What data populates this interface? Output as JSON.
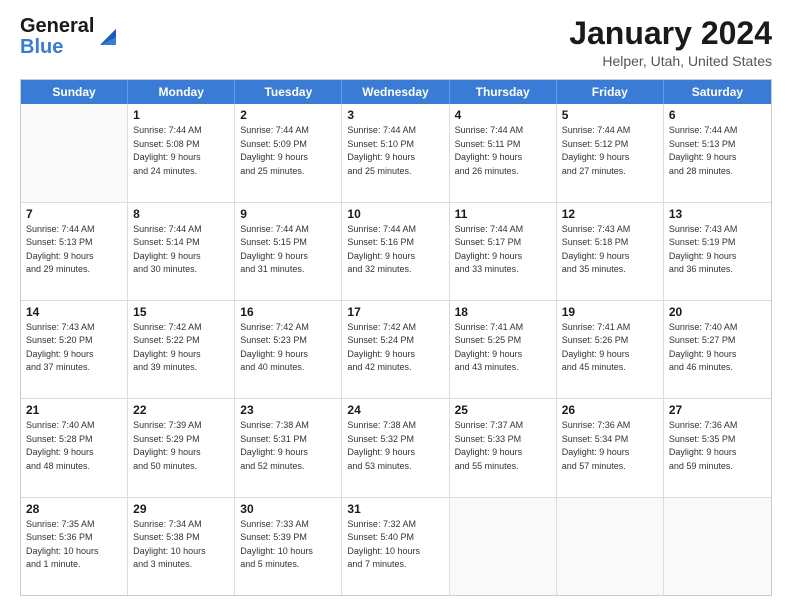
{
  "header": {
    "logo_line1": "General",
    "logo_line2": "Blue",
    "month_title": "January 2024",
    "location": "Helper, Utah, United States"
  },
  "calendar": {
    "days_of_week": [
      "Sunday",
      "Monday",
      "Tuesday",
      "Wednesday",
      "Thursday",
      "Friday",
      "Saturday"
    ],
    "weeks": [
      [
        {
          "day": "",
          "info": ""
        },
        {
          "day": "1",
          "info": "Sunrise: 7:44 AM\nSunset: 5:08 PM\nDaylight: 9 hours\nand 24 minutes."
        },
        {
          "day": "2",
          "info": "Sunrise: 7:44 AM\nSunset: 5:09 PM\nDaylight: 9 hours\nand 25 minutes."
        },
        {
          "day": "3",
          "info": "Sunrise: 7:44 AM\nSunset: 5:10 PM\nDaylight: 9 hours\nand 25 minutes."
        },
        {
          "day": "4",
          "info": "Sunrise: 7:44 AM\nSunset: 5:11 PM\nDaylight: 9 hours\nand 26 minutes."
        },
        {
          "day": "5",
          "info": "Sunrise: 7:44 AM\nSunset: 5:12 PM\nDaylight: 9 hours\nand 27 minutes."
        },
        {
          "day": "6",
          "info": "Sunrise: 7:44 AM\nSunset: 5:13 PM\nDaylight: 9 hours\nand 28 minutes."
        }
      ],
      [
        {
          "day": "7",
          "info": "Sunrise: 7:44 AM\nSunset: 5:13 PM\nDaylight: 9 hours\nand 29 minutes."
        },
        {
          "day": "8",
          "info": "Sunrise: 7:44 AM\nSunset: 5:14 PM\nDaylight: 9 hours\nand 30 minutes."
        },
        {
          "day": "9",
          "info": "Sunrise: 7:44 AM\nSunset: 5:15 PM\nDaylight: 9 hours\nand 31 minutes."
        },
        {
          "day": "10",
          "info": "Sunrise: 7:44 AM\nSunset: 5:16 PM\nDaylight: 9 hours\nand 32 minutes."
        },
        {
          "day": "11",
          "info": "Sunrise: 7:44 AM\nSunset: 5:17 PM\nDaylight: 9 hours\nand 33 minutes."
        },
        {
          "day": "12",
          "info": "Sunrise: 7:43 AM\nSunset: 5:18 PM\nDaylight: 9 hours\nand 35 minutes."
        },
        {
          "day": "13",
          "info": "Sunrise: 7:43 AM\nSunset: 5:19 PM\nDaylight: 9 hours\nand 36 minutes."
        }
      ],
      [
        {
          "day": "14",
          "info": "Sunrise: 7:43 AM\nSunset: 5:20 PM\nDaylight: 9 hours\nand 37 minutes."
        },
        {
          "day": "15",
          "info": "Sunrise: 7:42 AM\nSunset: 5:22 PM\nDaylight: 9 hours\nand 39 minutes."
        },
        {
          "day": "16",
          "info": "Sunrise: 7:42 AM\nSunset: 5:23 PM\nDaylight: 9 hours\nand 40 minutes."
        },
        {
          "day": "17",
          "info": "Sunrise: 7:42 AM\nSunset: 5:24 PM\nDaylight: 9 hours\nand 42 minutes."
        },
        {
          "day": "18",
          "info": "Sunrise: 7:41 AM\nSunset: 5:25 PM\nDaylight: 9 hours\nand 43 minutes."
        },
        {
          "day": "19",
          "info": "Sunrise: 7:41 AM\nSunset: 5:26 PM\nDaylight: 9 hours\nand 45 minutes."
        },
        {
          "day": "20",
          "info": "Sunrise: 7:40 AM\nSunset: 5:27 PM\nDaylight: 9 hours\nand 46 minutes."
        }
      ],
      [
        {
          "day": "21",
          "info": "Sunrise: 7:40 AM\nSunset: 5:28 PM\nDaylight: 9 hours\nand 48 minutes."
        },
        {
          "day": "22",
          "info": "Sunrise: 7:39 AM\nSunset: 5:29 PM\nDaylight: 9 hours\nand 50 minutes."
        },
        {
          "day": "23",
          "info": "Sunrise: 7:38 AM\nSunset: 5:31 PM\nDaylight: 9 hours\nand 52 minutes."
        },
        {
          "day": "24",
          "info": "Sunrise: 7:38 AM\nSunset: 5:32 PM\nDaylight: 9 hours\nand 53 minutes."
        },
        {
          "day": "25",
          "info": "Sunrise: 7:37 AM\nSunset: 5:33 PM\nDaylight: 9 hours\nand 55 minutes."
        },
        {
          "day": "26",
          "info": "Sunrise: 7:36 AM\nSunset: 5:34 PM\nDaylight: 9 hours\nand 57 minutes."
        },
        {
          "day": "27",
          "info": "Sunrise: 7:36 AM\nSunset: 5:35 PM\nDaylight: 9 hours\nand 59 minutes."
        }
      ],
      [
        {
          "day": "28",
          "info": "Sunrise: 7:35 AM\nSunset: 5:36 PM\nDaylight: 10 hours\nand 1 minute."
        },
        {
          "day": "29",
          "info": "Sunrise: 7:34 AM\nSunset: 5:38 PM\nDaylight: 10 hours\nand 3 minutes."
        },
        {
          "day": "30",
          "info": "Sunrise: 7:33 AM\nSunset: 5:39 PM\nDaylight: 10 hours\nand 5 minutes."
        },
        {
          "day": "31",
          "info": "Sunrise: 7:32 AM\nSunset: 5:40 PM\nDaylight: 10 hours\nand 7 minutes."
        },
        {
          "day": "",
          "info": ""
        },
        {
          "day": "",
          "info": ""
        },
        {
          "day": "",
          "info": ""
        }
      ]
    ]
  }
}
